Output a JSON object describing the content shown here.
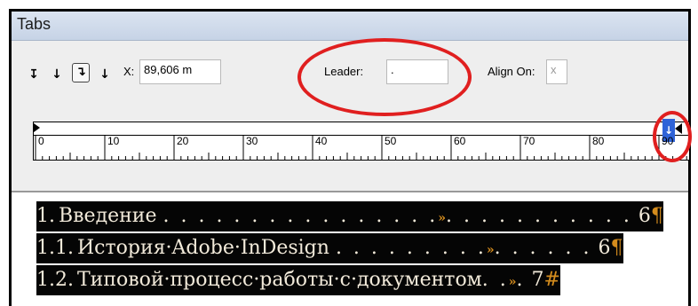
{
  "window": {
    "title": "Tabs"
  },
  "toolbar": {
    "tab_buttons": [
      {
        "name": "left-justified-tab",
        "symbol": "↧"
      },
      {
        "name": "center-justified-tab",
        "symbol": "↓"
      },
      {
        "name": "right-justified-tab",
        "symbol": "↴",
        "selected": true
      },
      {
        "name": "align-to-decimal-tab",
        "symbol": "↓"
      }
    ],
    "x_label": "X:",
    "x_value": "89,606 m",
    "leader_label": "Leader:",
    "leader_value": ".",
    "align_on_label": "Align On:",
    "align_on_value": "x"
  },
  "ruler": {
    "labels": [
      "0",
      "10",
      "20",
      "30",
      "40",
      "50",
      "60",
      "70",
      "80",
      "90"
    ],
    "tab_stop_symbol": "↓"
  },
  "document": {
    "toc": [
      {
        "number": "1.",
        "title": "Введение",
        "leader": ". . . . . . . . . . . . . . . .",
        "tab_mark": "»",
        "leader2": ". . . . . . . . . . .",
        "page": "6",
        "end_mark": "¶"
      },
      {
        "number": "1.1.",
        "title": "История·Adobe·InDesign",
        "leader": ". . . . . . . . .",
        "tab_mark": "»",
        "leader2": ". . . . . .",
        "page": "6",
        "end_mark": "¶"
      },
      {
        "number": "1.2.",
        "title": "Типовой·процесс·работы·с·документом",
        "leader": ". .",
        "tab_mark": "»",
        "leader2": ".",
        "page": "7",
        "end_mark": "#"
      }
    ]
  },
  "colors": {
    "annotation": "#e01f1f",
    "selection_bg": "#050505",
    "hidden_char": "#d48c1d",
    "tab_stop": "#2f63d8"
  }
}
